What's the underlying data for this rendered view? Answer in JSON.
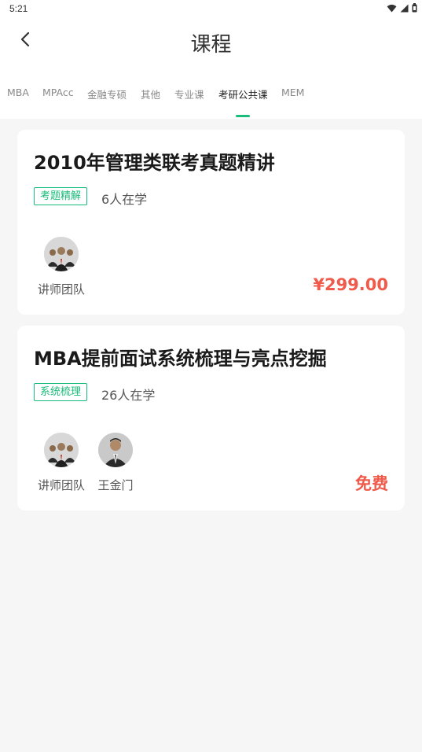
{
  "status_bar": {
    "time": "5:21",
    "wifi_icon": "wifi-icon",
    "signal_icon": "signal-icon",
    "battery_icon": "battery-icon"
  },
  "header": {
    "title": "课程",
    "back_icon": "chevron-left-icon"
  },
  "tabs": [
    {
      "label": "MBA",
      "active": false
    },
    {
      "label": "MPAcc",
      "active": false
    },
    {
      "label": "金融专硕",
      "active": false
    },
    {
      "label": "其他",
      "active": false
    },
    {
      "label": "专业课",
      "active": false
    },
    {
      "label": "考研公共课",
      "active": true
    },
    {
      "label": "MEM",
      "active": false
    }
  ],
  "colors": {
    "accent": "#1abc7b",
    "price": "#f05a4a",
    "background": "#f6f6f6"
  },
  "courses": [
    {
      "title": "2010年管理类联考真题精讲",
      "tag": "考题精解",
      "learners": "6人在学",
      "teachers": [
        {
          "name": "讲师团队",
          "avatar": "team-avatar-icon"
        }
      ],
      "price": "¥299.00"
    },
    {
      "title": "MBA提前面试系统梳理与亮点挖掘",
      "tag": "系统梳理",
      "learners": "26人在学",
      "teachers": [
        {
          "name": "讲师团队",
          "avatar": "team-avatar-icon"
        },
        {
          "name": "王金门",
          "avatar": "person-avatar-icon"
        }
      ],
      "price": "免费"
    }
  ]
}
